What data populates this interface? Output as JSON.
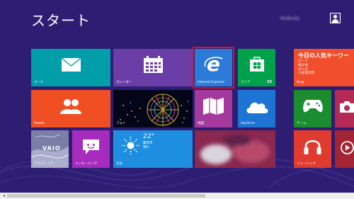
{
  "screen": {
    "title": "スタート"
  },
  "user": {
    "name": "NoBody"
  },
  "tiles": {
    "mail": {
      "label": "メール",
      "icon": "mail-icon"
    },
    "calendar": {
      "label": "カレンダー",
      "icon": "calendar-icon"
    },
    "ie": {
      "label": "Internet Explorer",
      "icon": "internet-explorer-icon"
    },
    "store": {
      "label": "ストア",
      "badge": "25",
      "icon": "store-icon"
    },
    "people": {
      "label": "People",
      "icon": "people-icon"
    },
    "photos": {
      "label": "フォト",
      "icon": "photo-icon"
    },
    "maps": {
      "label": "地図",
      "icon": "map-icon"
    },
    "skydrive": {
      "label": "SkyDrive",
      "icon": "cloud-icon"
    },
    "desktop": {
      "label": "デスクトップ",
      "logo": "VAIO"
    },
    "messaging": {
      "label": "メッセージング",
      "icon": "message-icon"
    },
    "weather": {
      "label": "天気",
      "temp": "22°",
      "city": "藤沢市",
      "detail": "晴れ",
      "icon": "sun-icon"
    },
    "bing": {
      "label": "Bing",
      "headline": "今日の人気キーワー",
      "lines": [
        "ローラ",
        "被災地",
        "ぴっぴ",
        "小泉進次郎"
      ]
    },
    "games": {
      "label": "ゲーム",
      "icon": "xbox-controller-icon"
    },
    "camera": {
      "icon": "camera-icon"
    },
    "music": {
      "label": "ミュージック",
      "icon": "headphones-icon"
    },
    "video": {
      "icon": "video-icon"
    }
  },
  "colors": {
    "background": "#2d1e73",
    "highlight": "#e2101a"
  }
}
